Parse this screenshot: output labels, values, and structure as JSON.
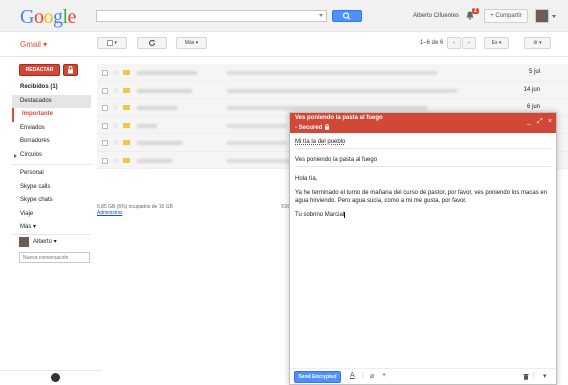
{
  "header": {
    "logo": [
      "G",
      "o",
      "o",
      "g",
      "l",
      "e"
    ],
    "user_name": "Alberto Cifuentes",
    "notification_count": "2",
    "share_label": "+ Compartir"
  },
  "toolbar": {
    "app_label": "Gmail",
    "more_label": "Más",
    "pager_text": "1–6 de 6",
    "lang_label": "Es"
  },
  "sidebar": {
    "compose_label": "REDACTAR",
    "items": [
      {
        "label": "Recibidos (1)"
      },
      {
        "label": "Destacados"
      },
      {
        "label": "Importante"
      },
      {
        "label": "Enviados"
      },
      {
        "label": "Borradores"
      },
      {
        "label": "Círculos"
      },
      {
        "label": "Personal"
      },
      {
        "label": "Skype calls"
      },
      {
        "label": "Skype chats"
      },
      {
        "label": "Viaje"
      },
      {
        "label": "Más"
      }
    ],
    "hangouts_user": "Alberto",
    "hangouts_placeholder": "Nueva conversación"
  },
  "list": {
    "dates": [
      "5 jul",
      "14 jun",
      "6 jun"
    ],
    "storage_text": "6,85 GB (6%) ocupados de 15 GB",
    "admin_label": "Administrar",
    "cut_text": "©20"
  },
  "compose": {
    "title_line1": "Ves poniendo la pasta al fuego",
    "title_line2": "- Secured",
    "to": "Mi tía la del pueblo",
    "subject": "Ves poniendo la pasta al fuego",
    "greeting": "Hola tía,",
    "body": "Ya he terminado el turno de mañana del curso de pastor, por favor, ves poniendo los macas en agua hirviendo. Pero agua sucia, como a mi me gusta, por favor.",
    "signature": "Tu sobrino Marcial",
    "send_label": "Send Encrypted"
  },
  "colors": {
    "compose_red": "#d14836",
    "send_blue": "#4d90fe"
  }
}
